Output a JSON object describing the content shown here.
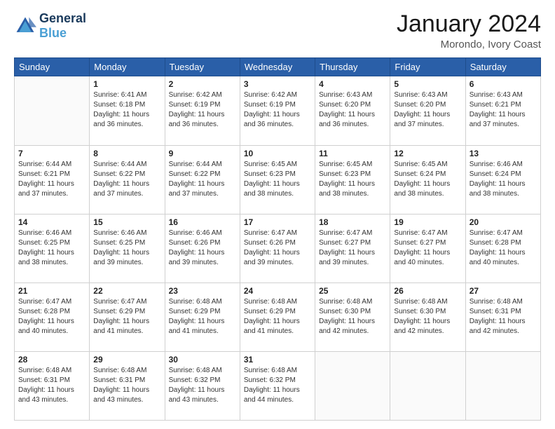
{
  "header": {
    "logo_line1": "General",
    "logo_line2": "Blue",
    "title": "January 2024",
    "subtitle": "Morondo, Ivory Coast"
  },
  "days_of_week": [
    "Sunday",
    "Monday",
    "Tuesday",
    "Wednesday",
    "Thursday",
    "Friday",
    "Saturday"
  ],
  "weeks": [
    [
      {
        "day": "",
        "info": ""
      },
      {
        "day": "1",
        "info": "Sunrise: 6:41 AM\nSunset: 6:18 PM\nDaylight: 11 hours\nand 36 minutes."
      },
      {
        "day": "2",
        "info": "Sunrise: 6:42 AM\nSunset: 6:19 PM\nDaylight: 11 hours\nand 36 minutes."
      },
      {
        "day": "3",
        "info": "Sunrise: 6:42 AM\nSunset: 6:19 PM\nDaylight: 11 hours\nand 36 minutes."
      },
      {
        "day": "4",
        "info": "Sunrise: 6:43 AM\nSunset: 6:20 PM\nDaylight: 11 hours\nand 36 minutes."
      },
      {
        "day": "5",
        "info": "Sunrise: 6:43 AM\nSunset: 6:20 PM\nDaylight: 11 hours\nand 37 minutes."
      },
      {
        "day": "6",
        "info": "Sunrise: 6:43 AM\nSunset: 6:21 PM\nDaylight: 11 hours\nand 37 minutes."
      }
    ],
    [
      {
        "day": "7",
        "info": "Sunrise: 6:44 AM\nSunset: 6:21 PM\nDaylight: 11 hours\nand 37 minutes."
      },
      {
        "day": "8",
        "info": "Sunrise: 6:44 AM\nSunset: 6:22 PM\nDaylight: 11 hours\nand 37 minutes."
      },
      {
        "day": "9",
        "info": "Sunrise: 6:44 AM\nSunset: 6:22 PM\nDaylight: 11 hours\nand 37 minutes."
      },
      {
        "day": "10",
        "info": "Sunrise: 6:45 AM\nSunset: 6:23 PM\nDaylight: 11 hours\nand 38 minutes."
      },
      {
        "day": "11",
        "info": "Sunrise: 6:45 AM\nSunset: 6:23 PM\nDaylight: 11 hours\nand 38 minutes."
      },
      {
        "day": "12",
        "info": "Sunrise: 6:45 AM\nSunset: 6:24 PM\nDaylight: 11 hours\nand 38 minutes."
      },
      {
        "day": "13",
        "info": "Sunrise: 6:46 AM\nSunset: 6:24 PM\nDaylight: 11 hours\nand 38 minutes."
      }
    ],
    [
      {
        "day": "14",
        "info": "Sunrise: 6:46 AM\nSunset: 6:25 PM\nDaylight: 11 hours\nand 38 minutes."
      },
      {
        "day": "15",
        "info": "Sunrise: 6:46 AM\nSunset: 6:25 PM\nDaylight: 11 hours\nand 39 minutes."
      },
      {
        "day": "16",
        "info": "Sunrise: 6:46 AM\nSunset: 6:26 PM\nDaylight: 11 hours\nand 39 minutes."
      },
      {
        "day": "17",
        "info": "Sunrise: 6:47 AM\nSunset: 6:26 PM\nDaylight: 11 hours\nand 39 minutes."
      },
      {
        "day": "18",
        "info": "Sunrise: 6:47 AM\nSunset: 6:27 PM\nDaylight: 11 hours\nand 39 minutes."
      },
      {
        "day": "19",
        "info": "Sunrise: 6:47 AM\nSunset: 6:27 PM\nDaylight: 11 hours\nand 40 minutes."
      },
      {
        "day": "20",
        "info": "Sunrise: 6:47 AM\nSunset: 6:28 PM\nDaylight: 11 hours\nand 40 minutes."
      }
    ],
    [
      {
        "day": "21",
        "info": "Sunrise: 6:47 AM\nSunset: 6:28 PM\nDaylight: 11 hours\nand 40 minutes."
      },
      {
        "day": "22",
        "info": "Sunrise: 6:47 AM\nSunset: 6:29 PM\nDaylight: 11 hours\nand 41 minutes."
      },
      {
        "day": "23",
        "info": "Sunrise: 6:48 AM\nSunset: 6:29 PM\nDaylight: 11 hours\nand 41 minutes."
      },
      {
        "day": "24",
        "info": "Sunrise: 6:48 AM\nSunset: 6:29 PM\nDaylight: 11 hours\nand 41 minutes."
      },
      {
        "day": "25",
        "info": "Sunrise: 6:48 AM\nSunset: 6:30 PM\nDaylight: 11 hours\nand 42 minutes."
      },
      {
        "day": "26",
        "info": "Sunrise: 6:48 AM\nSunset: 6:30 PM\nDaylight: 11 hours\nand 42 minutes."
      },
      {
        "day": "27",
        "info": "Sunrise: 6:48 AM\nSunset: 6:31 PM\nDaylight: 11 hours\nand 42 minutes."
      }
    ],
    [
      {
        "day": "28",
        "info": "Sunrise: 6:48 AM\nSunset: 6:31 PM\nDaylight: 11 hours\nand 43 minutes."
      },
      {
        "day": "29",
        "info": "Sunrise: 6:48 AM\nSunset: 6:31 PM\nDaylight: 11 hours\nand 43 minutes."
      },
      {
        "day": "30",
        "info": "Sunrise: 6:48 AM\nSunset: 6:32 PM\nDaylight: 11 hours\nand 43 minutes."
      },
      {
        "day": "31",
        "info": "Sunrise: 6:48 AM\nSunset: 6:32 PM\nDaylight: 11 hours\nand 44 minutes."
      },
      {
        "day": "",
        "info": ""
      },
      {
        "day": "",
        "info": ""
      },
      {
        "day": "",
        "info": ""
      }
    ]
  ]
}
